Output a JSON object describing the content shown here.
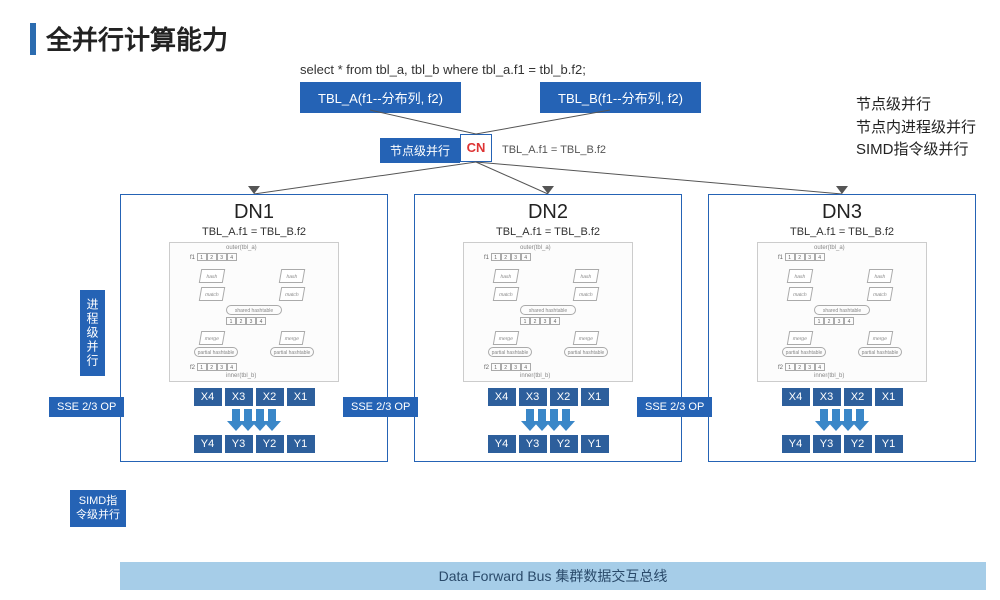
{
  "title": "全并行计算能力",
  "sql": "select * from tbl_a, tbl_b where tbl_a.f1 = tbl_b.f2;",
  "tbl_a": "TBL_A(f1--分布列, f2)",
  "tbl_b": "TBL_B(f1--分布列, f2)",
  "node_label": "节点级并行",
  "cn": "CN",
  "cn_cond": "TBL_A.f1 = TBL_B.f2",
  "right_list": {
    "a": "节点级并行",
    "b": "节点内进程级并行",
    "c": "SIMD指令级并行"
  },
  "dn": {
    "titles": [
      "DN1",
      "DN2",
      "DN3"
    ],
    "cond": "TBL_A.f1 = TBL_B.f2",
    "plan": {
      "outer": "outer(tbl_a)",
      "f1": "f1",
      "cells": [
        "1",
        "2",
        "3",
        "4"
      ],
      "hash": "hash",
      "match": "match",
      "shared": "shared hashtable",
      "merge": "merge",
      "partial": "partial hashtable",
      "f2": "f2",
      "inner": "inner(tbl_b)"
    },
    "x": [
      "X4",
      "X3",
      "X2",
      "X1"
    ],
    "y": [
      "Y4",
      "Y3",
      "Y2",
      "Y1"
    ],
    "sse": "SSE 2/3 OP"
  },
  "left_proc": "进程级并行",
  "left_simd": "SIMD指令级并行",
  "bus": "Data Forward Bus    集群数据交互总线"
}
